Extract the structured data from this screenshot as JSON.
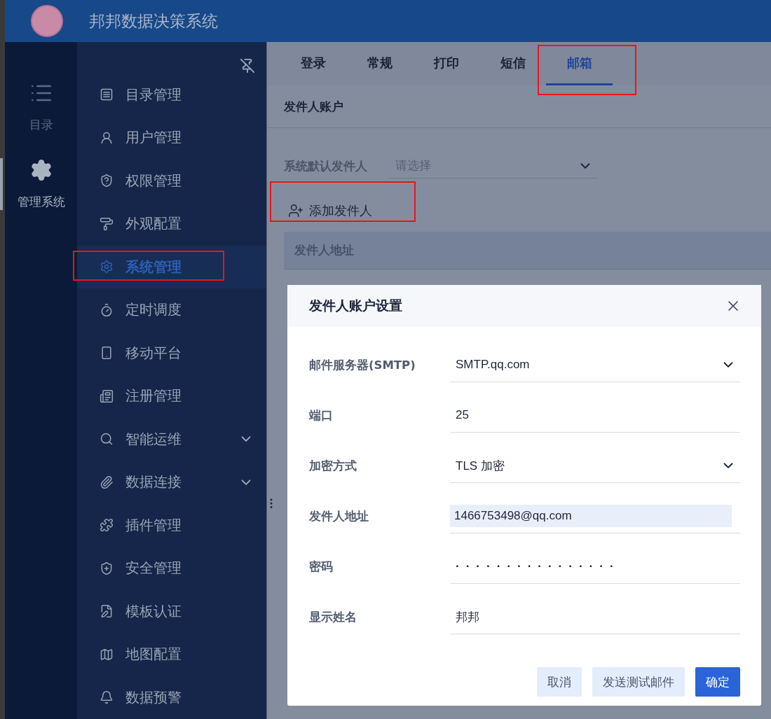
{
  "header": {
    "title": "邦邦数据决策系统"
  },
  "rail": [
    {
      "label": "目录",
      "selected": false
    },
    {
      "label": "管理系统",
      "selected": true
    }
  ],
  "sidebar": {
    "items": [
      {
        "label": "目录管理",
        "selected": false,
        "highlighted": false
      },
      {
        "label": "用户管理",
        "selected": false,
        "highlighted": false
      },
      {
        "label": "权限管理",
        "selected": false,
        "highlighted": false
      },
      {
        "label": "外观配置",
        "selected": false,
        "highlighted": false
      },
      {
        "label": "系统管理",
        "selected": true,
        "highlighted": true
      },
      {
        "label": "定时调度",
        "selected": false,
        "highlighted": false
      },
      {
        "label": "移动平台",
        "selected": false,
        "highlighted": false
      },
      {
        "label": "注册管理",
        "selected": false,
        "highlighted": false
      },
      {
        "label": "智能运维",
        "selected": false,
        "highlighted": false,
        "expanded": false
      },
      {
        "label": "数据连接",
        "selected": false,
        "highlighted": false,
        "expanded": false
      },
      {
        "label": "插件管理",
        "selected": false,
        "highlighted": false
      },
      {
        "label": "安全管理",
        "selected": false,
        "highlighted": false
      },
      {
        "label": "模板认证",
        "selected": false,
        "highlighted": false
      },
      {
        "label": "地图配置",
        "selected": false,
        "highlighted": false
      },
      {
        "label": "数据预警",
        "selected": false,
        "highlighted": false
      }
    ]
  },
  "tabs": [
    {
      "label": "登录",
      "selected": false,
      "highlighted": false
    },
    {
      "label": "常规",
      "selected": false,
      "highlighted": false
    },
    {
      "label": "打印",
      "selected": false,
      "highlighted": false
    },
    {
      "label": "短信",
      "selected": false,
      "highlighted": false
    },
    {
      "label": "邮箱",
      "selected": true,
      "highlighted": true
    }
  ],
  "section": {
    "title": "发件人账户",
    "default_sender": {
      "label": "系统默认发件人",
      "placeholder": "请选择"
    },
    "add_button": {
      "label": "添加发件人",
      "highlighted": true
    },
    "table": {
      "columns": [
        "发件人地址"
      ]
    }
  },
  "dialog": {
    "title": "发件人账户设置",
    "fields": [
      {
        "label": "邮件服务器(SMTP)",
        "kind": "select",
        "value": "SMTP.qq.com",
        "autofilled": false
      },
      {
        "label": "端口",
        "kind": "text",
        "value": "25",
        "autofilled": false
      },
      {
        "label": "加密方式",
        "kind": "select",
        "value": "TLS 加密",
        "autofilled": false
      },
      {
        "label": "发件人地址",
        "kind": "text",
        "value": "1466753498@qq.com",
        "autofilled": true
      },
      {
        "label": "密码",
        "kind": "password",
        "value": "················",
        "autofilled": false
      },
      {
        "label": "显示姓名",
        "kind": "text",
        "value": "邦邦",
        "autofilled": false
      }
    ],
    "buttons": [
      {
        "label": "取消",
        "kind": "secondary"
      },
      {
        "label": "发送测试邮件",
        "kind": "secondary"
      },
      {
        "label": "确定",
        "kind": "primary"
      }
    ]
  }
}
